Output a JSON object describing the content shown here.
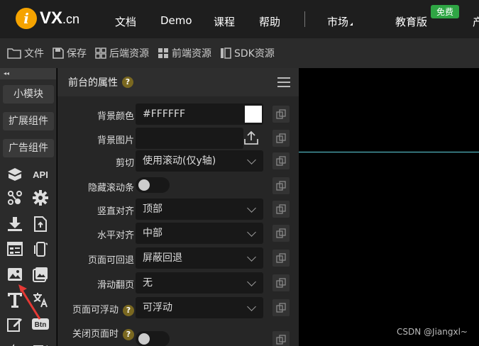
{
  "topnav": {
    "logo_letter": "i",
    "logo_main": "VX",
    "logo_suffix": ".cn",
    "items": [
      "文档",
      "Demo",
      "课程",
      "帮助",
      "市场",
      "教育版",
      "产"
    ],
    "free_badge": "免费"
  },
  "toolbar": {
    "items": [
      "文件",
      "保存",
      "后端资源",
      "前端资源",
      "SDK资源"
    ]
  },
  "sidebar": {
    "collapse": "◂◂",
    "buttons": [
      "小模块",
      "扩展组件",
      "广告组件"
    ],
    "api_label": "API",
    "btn_label": "Btn"
  },
  "panel": {
    "title": "前台的属性",
    "help": "?",
    "rows": [
      {
        "label": "背景颜色",
        "value": "#FFFFFF"
      },
      {
        "label": "背景图片",
        "value": ""
      },
      {
        "label": "剪切",
        "value": "使用滚动(仅y轴)"
      },
      {
        "label": "隐藏滚动条",
        "value": ""
      },
      {
        "label": "竖直对齐",
        "value": "顶部"
      },
      {
        "label": "水平对齐",
        "value": "中部"
      },
      {
        "label": "页面可回退",
        "value": "屏蔽回退"
      },
      {
        "label": "滑动翻页",
        "value": "无"
      },
      {
        "label": "页面可浮动",
        "value": "可浮动"
      },
      {
        "label": "关闭页面时",
        "value": ""
      }
    ],
    "swatch_color": "#FFFFFF"
  },
  "canvas": {
    "watermark": "CSDN @Jiangxl~"
  },
  "colors": {
    "accent_orange": "#f5a300",
    "badge_green": "#2fa544",
    "guide_cyan": "#5fd3df",
    "arrow_red": "#e53935"
  }
}
